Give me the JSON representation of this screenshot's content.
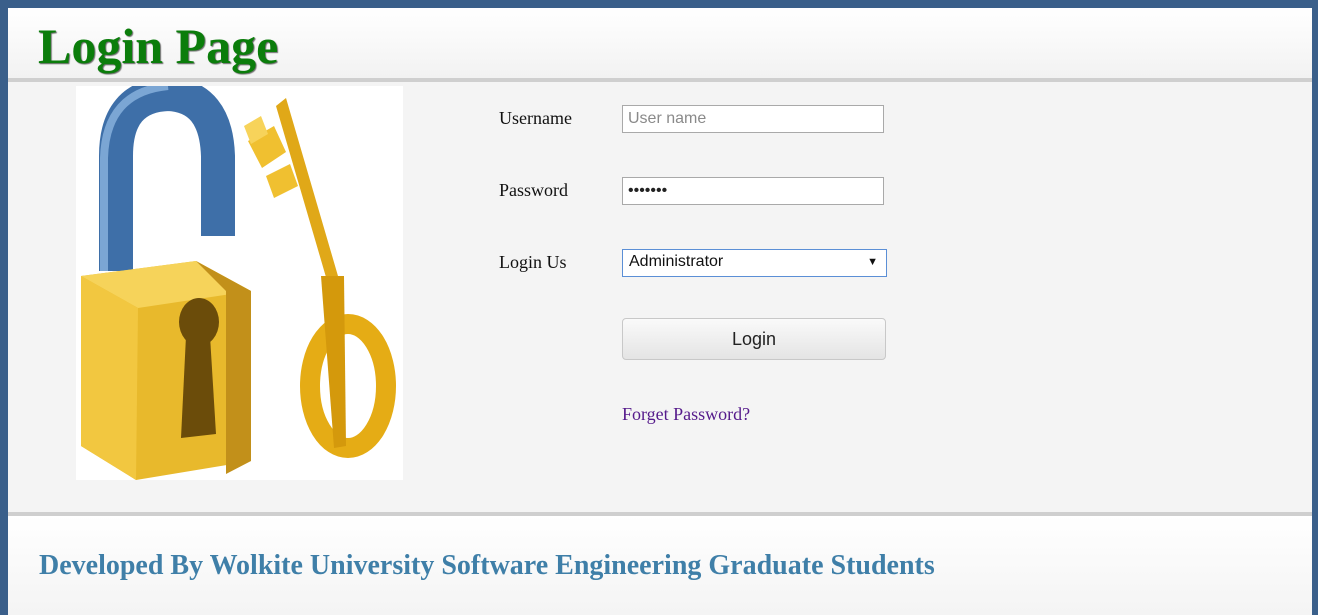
{
  "header": {
    "title": "Login Page"
  },
  "image": {
    "name": "padlock-and-key-image"
  },
  "form": {
    "username": {
      "label": "Username",
      "placeholder": "User name",
      "value": ""
    },
    "password": {
      "label": "Password",
      "value": "•••••••"
    },
    "login_as": {
      "label": "Login Us",
      "selected": "Administrator"
    },
    "login_button": "Login",
    "forget_password": "Forget Password?"
  },
  "footer": {
    "text": "Developed By Wolkite University Software Engineering Graduate Students"
  },
  "colors": {
    "title": "#0b7d0b",
    "footer": "#3f7fa8",
    "link": "#551a8b"
  }
}
